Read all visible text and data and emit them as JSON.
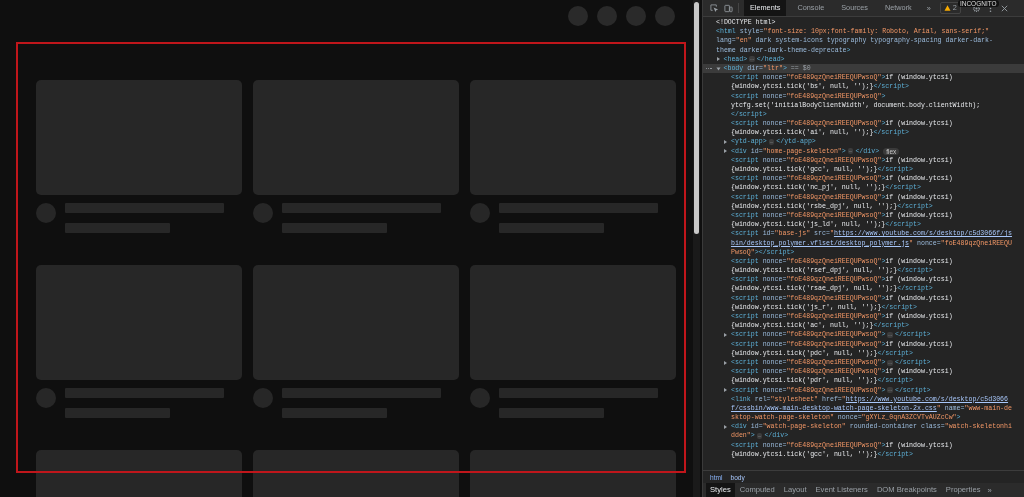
{
  "page": {
    "highlighted": true
  },
  "devtools": {
    "tabs": [
      {
        "label": "Elements",
        "selected": true
      },
      {
        "label": "Console",
        "selected": false
      },
      {
        "label": "Sources",
        "selected": false
      },
      {
        "label": "Network",
        "selected": false
      }
    ],
    "more_tabs": "»",
    "warnings": "2",
    "incognito": "INCOGNITO"
  },
  "dom": [
    {
      "lines": [
        [
          {
            "kind": "text",
            "text": "<!DOCTYPE html>"
          }
        ]
      ]
    },
    {
      "lines": [
        [
          {
            "kind": "tag",
            "text": "<html"
          },
          {
            "kind": "attr",
            "text": " style="
          },
          {
            "kind": "value",
            "text": "\"font-size: 10px;font-family: Roboto, Arial, sans-serif;\""
          }
        ],
        [
          {
            "kind": "attr",
            "text": "lang="
          },
          {
            "kind": "value",
            "text": "\"en\""
          },
          {
            "kind": "attr",
            "text": " dark system-icons typography typography-spacing darker-dark-"
          }
        ],
        [
          {
            "kind": "attr",
            "text": "theme darker-dark-theme-deprecate"
          },
          {
            "kind": "tag",
            "text": ">"
          }
        ]
      ],
      "children": [
        {
          "expanded": false,
          "lines": [
            [
              {
                "kind": "tag",
                "text": "<head>"
              },
              {
                "kind": "ellipsis",
                "text": "…"
              },
              {
                "kind": "tag",
                "text": "</head>"
              }
            ]
          ]
        },
        {
          "expanded": true,
          "selected": true,
          "lines": [
            [
              {
                "kind": "tag",
                "text": "<body"
              },
              {
                "kind": "attr",
                "text": " dir="
              },
              {
                "kind": "value",
                "text": "\"ltr\""
              },
              {
                "kind": "tag",
                "text": ">"
              },
              {
                "kind": "hint",
                "text": " == $0"
              }
            ]
          ],
          "children": [
            {
              "lines": [
                [
                  {
                    "kind": "tag",
                    "text": "<script"
                  },
                  {
                    "kind": "attr",
                    "text": " nonce="
                  },
                  {
                    "kind": "value",
                    "text": "\"foE489qzQneiREEQUPwsoQ\""
                  },
                  {
                    "kind": "tag",
                    "text": ">"
                  },
                  {
                    "kind": "text",
                    "text": "if (window.ytcsi)"
                  }
                ],
                [
                  {
                    "kind": "text",
                    "text": "{window.ytcsi.tick('bs', null, '');}"
                  },
                  {
                    "kind": "tag",
                    "text": "</script>"
                  }
                ]
              ]
            },
            {
              "lines": [
                [
                  {
                    "kind": "tag",
                    "text": "<script"
                  },
                  {
                    "kind": "attr",
                    "text": " nonce="
                  },
                  {
                    "kind": "value",
                    "text": "\"foE489qzQneiREEQUPwsoQ\""
                  },
                  {
                    "kind": "tag",
                    "text": ">"
                  }
                ],
                [
                  {
                    "kind": "text",
                    "text": "ytcfg.set('initialBodyClientWidth', document.body.clientWidth);"
                  }
                ],
                [
                  {
                    "kind": "tag",
                    "text": "</script>"
                  }
                ]
              ]
            },
            {
              "lines": [
                [
                  {
                    "kind": "tag",
                    "text": "<script"
                  },
                  {
                    "kind": "attr",
                    "text": " nonce="
                  },
                  {
                    "kind": "value",
                    "text": "\"foE489qzQneiREEQUPwsoQ\""
                  },
                  {
                    "kind": "tag",
                    "text": ">"
                  },
                  {
                    "kind": "text",
                    "text": "if (window.ytcsi)"
                  }
                ],
                [
                  {
                    "kind": "text",
                    "text": "{window.ytcsi.tick('ai', null, '');}"
                  },
                  {
                    "kind": "tag",
                    "text": "</script>"
                  }
                ]
              ]
            },
            {
              "expanded": false,
              "lines": [
                [
                  {
                    "kind": "tag",
                    "text": "<ytd-app>"
                  },
                  {
                    "kind": "ellipsis",
                    "text": "…"
                  },
                  {
                    "kind": "tag",
                    "text": "</ytd-app>"
                  }
                ]
              ]
            },
            {
              "expanded": false,
              "lines": [
                [
                  {
                    "kind": "tag",
                    "text": "<div"
                  },
                  {
                    "kind": "attr",
                    "text": " id="
                  },
                  {
                    "kind": "value",
                    "text": "\"home-page-skeleton\""
                  },
                  {
                    "kind": "tag",
                    "text": ">"
                  },
                  {
                    "kind": "ellipsis",
                    "text": "…"
                  },
                  {
                    "kind": "tag",
                    "text": "</div>"
                  },
                  {
                    "kind": "badge",
                    "text": "flex"
                  }
                ]
              ]
            },
            {
              "lines": [
                [
                  {
                    "kind": "tag",
                    "text": "<script"
                  },
                  {
                    "kind": "attr",
                    "text": " nonce="
                  },
                  {
                    "kind": "value",
                    "text": "\"foE489qzQneiREEQUPwsoQ\""
                  },
                  {
                    "kind": "tag",
                    "text": ">"
                  },
                  {
                    "kind": "text",
                    "text": "if (window.ytcsi)"
                  }
                ],
                [
                  {
                    "kind": "text",
                    "text": "{window.ytcsi.tick('gcc', null, '');}"
                  },
                  {
                    "kind": "tag",
                    "text": "</script>"
                  }
                ]
              ]
            },
            {
              "lines": [
                [
                  {
                    "kind": "tag",
                    "text": "<script"
                  },
                  {
                    "kind": "attr",
                    "text": " nonce="
                  },
                  {
                    "kind": "value",
                    "text": "\"foE489qzQneiREEQUPwsoQ\""
                  },
                  {
                    "kind": "tag",
                    "text": ">"
                  },
                  {
                    "kind": "text",
                    "text": "if (window.ytcsi)"
                  }
                ],
                [
                  {
                    "kind": "text",
                    "text": "{window.ytcsi.tick('nc_pj', null, '');}"
                  },
                  {
                    "kind": "tag",
                    "text": "</script>"
                  }
                ]
              ]
            },
            {
              "lines": [
                [
                  {
                    "kind": "tag",
                    "text": "<script"
                  },
                  {
                    "kind": "attr",
                    "text": " nonce="
                  },
                  {
                    "kind": "value",
                    "text": "\"foE489qzQneiREEQUPwsoQ\""
                  },
                  {
                    "kind": "tag",
                    "text": ">"
                  },
                  {
                    "kind": "text",
                    "text": "if (window.ytcsi)"
                  }
                ],
                [
                  {
                    "kind": "text",
                    "text": "{window.ytcsi.tick('rsbe_dpj', null, '');}"
                  },
                  {
                    "kind": "tag",
                    "text": "</script>"
                  }
                ]
              ]
            },
            {
              "lines": [
                [
                  {
                    "kind": "tag",
                    "text": "<script"
                  },
                  {
                    "kind": "attr",
                    "text": " nonce="
                  },
                  {
                    "kind": "value",
                    "text": "\"foE489qzQneiREEQUPwsoQ\""
                  },
                  {
                    "kind": "tag",
                    "text": ">"
                  },
                  {
                    "kind": "text",
                    "text": "if (window.ytcsi)"
                  }
                ],
                [
                  {
                    "kind": "text",
                    "text": "{window.ytcsi.tick('js_ld', null, '');}"
                  },
                  {
                    "kind": "tag",
                    "text": "</script>"
                  }
                ]
              ]
            },
            {
              "lines": [
                [
                  {
                    "kind": "tag",
                    "text": "<script"
                  },
                  {
                    "kind": "attr",
                    "text": " id="
                  },
                  {
                    "kind": "value",
                    "text": "\"base-js\""
                  },
                  {
                    "kind": "attr",
                    "text": " src="
                  },
                  {
                    "kind": "value",
                    "text": "\""
                  },
                  {
                    "kind": "link",
                    "text": "https://www.youtube.com/s/desktop/c5d3066f/js"
                  }
                ],
                [
                  {
                    "kind": "link",
                    "text": "bin/desktop_polymer.vflset/desktop_polymer.js"
                  },
                  {
                    "kind": "value",
                    "text": "\""
                  },
                  {
                    "kind": "attr",
                    "text": " nonce="
                  },
                  {
                    "kind": "value",
                    "text": "\"foE489qzQneiREEQU"
                  }
                ],
                [
                  {
                    "kind": "value",
                    "text": "PwsoQ\""
                  },
                  {
                    "kind": "tag",
                    "text": "></script>"
                  }
                ]
              ]
            },
            {
              "lines": [
                [
                  {
                    "kind": "tag",
                    "text": "<script"
                  },
                  {
                    "kind": "attr",
                    "text": " nonce="
                  },
                  {
                    "kind": "value",
                    "text": "\"foE489qzQneiREEQUPwsoQ\""
                  },
                  {
                    "kind": "tag",
                    "text": ">"
                  },
                  {
                    "kind": "text",
                    "text": "if (window.ytcsi)"
                  }
                ],
                [
                  {
                    "kind": "text",
                    "text": "{window.ytcsi.tick('rsef_dpj', null, '');}"
                  },
                  {
                    "kind": "tag",
                    "text": "</script>"
                  }
                ]
              ]
            },
            {
              "lines": [
                [
                  {
                    "kind": "tag",
                    "text": "<script"
                  },
                  {
                    "kind": "attr",
                    "text": " nonce="
                  },
                  {
                    "kind": "value",
                    "text": "\"foE489qzQneiREEQUPwsoQ\""
                  },
                  {
                    "kind": "tag",
                    "text": ">"
                  },
                  {
                    "kind": "text",
                    "text": "if (window.ytcsi)"
                  }
                ],
                [
                  {
                    "kind": "text",
                    "text": "{window.ytcsi.tick('rsae_dpj', null, '');}"
                  },
                  {
                    "kind": "tag",
                    "text": "</script>"
                  }
                ]
              ]
            },
            {
              "lines": [
                [
                  {
                    "kind": "tag",
                    "text": "<script"
                  },
                  {
                    "kind": "attr",
                    "text": " nonce="
                  },
                  {
                    "kind": "value",
                    "text": "\"foE489qzQneiREEQUPwsoQ\""
                  },
                  {
                    "kind": "tag",
                    "text": ">"
                  },
                  {
                    "kind": "text",
                    "text": "if (window.ytcsi)"
                  }
                ],
                [
                  {
                    "kind": "text",
                    "text": "{window.ytcsi.tick('js_r', null, '');}"
                  },
                  {
                    "kind": "tag",
                    "text": "</script>"
                  }
                ]
              ]
            },
            {
              "lines": [
                [
                  {
                    "kind": "tag",
                    "text": "<script"
                  },
                  {
                    "kind": "attr",
                    "text": " nonce="
                  },
                  {
                    "kind": "value",
                    "text": "\"foE489qzQneiREEQUPwsoQ\""
                  },
                  {
                    "kind": "tag",
                    "text": ">"
                  },
                  {
                    "kind": "text",
                    "text": "if (window.ytcsi)"
                  }
                ],
                [
                  {
                    "kind": "text",
                    "text": "{window.ytcsi.tick('ac', null, '');}"
                  },
                  {
                    "kind": "tag",
                    "text": "</script>"
                  }
                ]
              ]
            },
            {
              "expanded": false,
              "lines": [
                [
                  {
                    "kind": "tag",
                    "text": "<script"
                  },
                  {
                    "kind": "attr",
                    "text": " nonce="
                  },
                  {
                    "kind": "value",
                    "text": "\"foE489qzQneiREEQUPwsoQ\""
                  },
                  {
                    "kind": "tag",
                    "text": ">"
                  },
                  {
                    "kind": "ellipsis",
                    "text": "…"
                  },
                  {
                    "kind": "tag",
                    "text": "</script>"
                  }
                ]
              ]
            },
            {
              "lines": [
                [
                  {
                    "kind": "tag",
                    "text": "<script"
                  },
                  {
                    "kind": "attr",
                    "text": " nonce="
                  },
                  {
                    "kind": "value",
                    "text": "\"foE489qzQneiREEQUPwsoQ\""
                  },
                  {
                    "kind": "tag",
                    "text": ">"
                  },
                  {
                    "kind": "text",
                    "text": "if (window.ytcsi)"
                  }
                ],
                [
                  {
                    "kind": "text",
                    "text": "{window.ytcsi.tick('pdc', null, '');}"
                  },
                  {
                    "kind": "tag",
                    "text": "</script>"
                  }
                ]
              ]
            },
            {
              "expanded": false,
              "lines": [
                [
                  {
                    "kind": "tag",
                    "text": "<script"
                  },
                  {
                    "kind": "attr",
                    "text": " nonce="
                  },
                  {
                    "kind": "value",
                    "text": "\"foE489qzQneiREEQUPwsoQ\""
                  },
                  {
                    "kind": "tag",
                    "text": ">"
                  },
                  {
                    "kind": "ellipsis",
                    "text": "…"
                  },
                  {
                    "kind": "tag",
                    "text": "</script>"
                  }
                ]
              ]
            },
            {
              "lines": [
                [
                  {
                    "kind": "tag",
                    "text": "<script"
                  },
                  {
                    "kind": "attr",
                    "text": " nonce="
                  },
                  {
                    "kind": "value",
                    "text": "\"foE489qzQneiREEQUPwsoQ\""
                  },
                  {
                    "kind": "tag",
                    "text": ">"
                  },
                  {
                    "kind": "text",
                    "text": "if (window.ytcsi)"
                  }
                ],
                [
                  {
                    "kind": "text",
                    "text": "{window.ytcsi.tick('pdr', null, '');}"
                  },
                  {
                    "kind": "tag",
                    "text": "</script>"
                  }
                ]
              ]
            },
            {
              "expanded": false,
              "lines": [
                [
                  {
                    "kind": "tag",
                    "text": "<script"
                  },
                  {
                    "kind": "attr",
                    "text": " nonce="
                  },
                  {
                    "kind": "value",
                    "text": "\"foE489qzQneiREEQUPwsoQ\""
                  },
                  {
                    "kind": "tag",
                    "text": ">"
                  },
                  {
                    "kind": "ellipsis",
                    "text": "…"
                  },
                  {
                    "kind": "tag",
                    "text": "</script>"
                  }
                ]
              ]
            },
            {
              "lines": [
                [
                  {
                    "kind": "tag",
                    "text": "<link"
                  },
                  {
                    "kind": "attr",
                    "text": " rel="
                  },
                  {
                    "kind": "value",
                    "text": "\"stylesheet\""
                  },
                  {
                    "kind": "attr",
                    "text": " href="
                  },
                  {
                    "kind": "value",
                    "text": "\""
                  },
                  {
                    "kind": "link",
                    "text": "https://www.youtube.com/s/desktop/c5d3066"
                  }
                ],
                [
                  {
                    "kind": "link",
                    "text": "f/cssbin/www-main-desktop-watch-page-skeleton-2x.css"
                  },
                  {
                    "kind": "value",
                    "text": "\""
                  },
                  {
                    "kind": "attr",
                    "text": " name="
                  },
                  {
                    "kind": "value",
                    "text": "\"www-main-de"
                  }
                ],
                [
                  {
                    "kind": "value",
                    "text": "sktop-watch-page-skeleton\""
                  },
                  {
                    "kind": "attr",
                    "text": " nonce="
                  },
                  {
                    "kind": "value",
                    "text": "\"gXYLz_0qnA3ZCVTvAUZcCw\""
                  },
                  {
                    "kind": "tag",
                    "text": ">"
                  }
                ]
              ]
            },
            {
              "expanded": false,
              "lines": [
                [
                  {
                    "kind": "tag",
                    "text": "<div"
                  },
                  {
                    "kind": "attr",
                    "text": " id="
                  },
                  {
                    "kind": "value",
                    "text": "\"watch-page-skeleton\""
                  },
                  {
                    "kind": "attr",
                    "text": " rounded-container class="
                  },
                  {
                    "kind": "value",
                    "text": "\"watch-skeletonhi"
                  }
                ],
                [
                  {
                    "kind": "value",
                    "text": "dden\""
                  },
                  {
                    "kind": "tag",
                    "text": ">"
                  },
                  {
                    "kind": "ellipsis",
                    "text": "…"
                  },
                  {
                    "kind": "tag",
                    "text": "</div>"
                  }
                ]
              ]
            },
            {
              "lines": [
                [
                  {
                    "kind": "tag",
                    "text": "<script"
                  },
                  {
                    "kind": "attr",
                    "text": " nonce="
                  },
                  {
                    "kind": "value",
                    "text": "\"foE489qzQneiREEQUPwsoQ\""
                  },
                  {
                    "kind": "tag",
                    "text": ">"
                  },
                  {
                    "kind": "text",
                    "text": "if (window.ytcsi)"
                  }
                ],
                [
                  {
                    "kind": "text",
                    "text": "{window.ytcsi.tick('gcc', null, '');}"
                  },
                  {
                    "kind": "tag",
                    "text": "</script>"
                  }
                ]
              ]
            }
          ]
        }
      ]
    }
  ],
  "breadcrumbs": [
    {
      "label": "html",
      "selected": false
    },
    {
      "label": "body",
      "selected": true
    }
  ],
  "panel_tabs": [
    {
      "label": "Styles",
      "selected": true
    },
    {
      "label": "Computed",
      "selected": false
    },
    {
      "label": "Layout",
      "selected": false
    },
    {
      "label": "Event Listeners",
      "selected": false
    },
    {
      "label": "DOM Breakpoints",
      "selected": false
    },
    {
      "label": "Properties",
      "selected": false
    }
  ],
  "more_panel_tabs": "»"
}
